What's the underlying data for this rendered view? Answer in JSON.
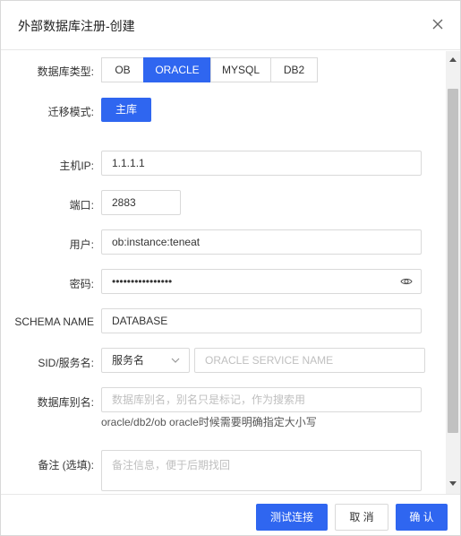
{
  "dialog": {
    "title": "外部数据库注册-创建",
    "close_icon": "close-icon"
  },
  "form": {
    "db_type": {
      "label": "数据库类型:",
      "options": [
        "OB",
        "ORACLE",
        "MYSQL",
        "DB2"
      ],
      "selected": "ORACLE"
    },
    "migration_mode": {
      "label": "迁移模式:",
      "value": "主库"
    },
    "host_ip": {
      "label": "主机IP:",
      "value": "1.1.1.1"
    },
    "port": {
      "label": "端口:",
      "value": "2883"
    },
    "user": {
      "label": "用户:",
      "value": "ob:instance:teneat"
    },
    "password": {
      "label": "密码:",
      "value": "••••••••••••••••",
      "toggle_icon": "eye-icon"
    },
    "schema_name": {
      "label": "SCHEMA NAME",
      "value": "DATABASE"
    },
    "sid": {
      "label": "SID/服务名:",
      "select_value": "服务名",
      "placeholder": "ORACLE SERVICE NAME"
    },
    "alias": {
      "label": "数据库别名:",
      "placeholder": "数据库别名，别名只是标记，作为搜索用",
      "hint": "oracle/db2/ob oracle时候需要明确指定大小写"
    },
    "remark": {
      "label": "备注 (选填):",
      "placeholder": "备注信息，便于后期找回"
    }
  },
  "footer": {
    "test_label": "测试连接",
    "cancel_label": "取 消",
    "confirm_label": "确 认"
  },
  "colors": {
    "primary": "#2f66f0",
    "border": "#d9d9d9"
  }
}
